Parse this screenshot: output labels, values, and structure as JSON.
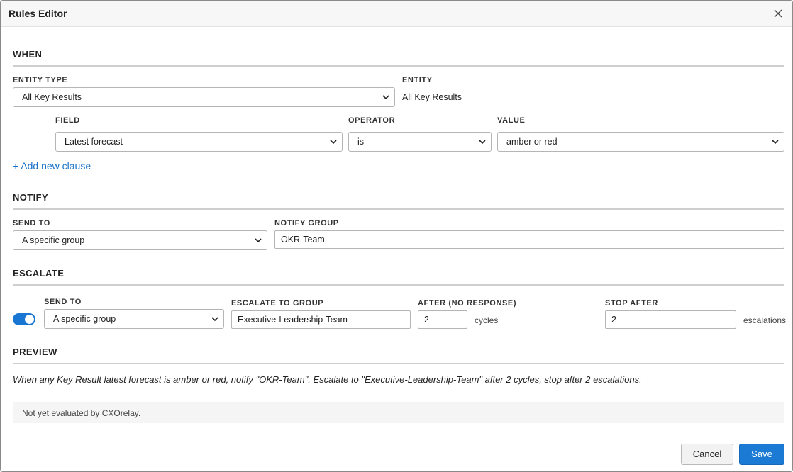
{
  "dialog": {
    "title": "Rules Editor"
  },
  "when": {
    "section_title": "WHEN",
    "entity_type_label": "ENTITY TYPE",
    "entity_type_value": "All Key Results",
    "entity_label": "ENTITY",
    "entity_value": "All Key Results",
    "field_label": "FIELD",
    "field_value": "Latest forecast",
    "operator_label": "OPERATOR",
    "operator_value": "is",
    "value_label": "VALUE",
    "value_value": "amber or red",
    "add_clause_label": "+ Add new clause"
  },
  "notify": {
    "section_title": "NOTIFY",
    "send_to_label": "SEND TO",
    "send_to_value": "A specific group",
    "group_label": "NOTIFY GROUP",
    "group_value": "OKR-Team"
  },
  "escalate": {
    "section_title": "ESCALATE",
    "enabled": true,
    "send_to_label": "SEND TO",
    "send_to_value": "A specific group",
    "group_label": "ESCALATE TO GROUP",
    "group_value": "Executive-Leadership-Team",
    "after_label": "AFTER (NO RESPONSE)",
    "after_value": "2",
    "after_unit": "cycles",
    "stop_label": "STOP AFTER",
    "stop_value": "2",
    "stop_unit": "escalations"
  },
  "preview": {
    "section_title": "PREVIEW",
    "text": "When any Key Result latest forecast is amber or red, notify \"OKR-Team\". Escalate to \"Executive-Leadership-Team\" after 2 cycles, stop after 2 escalations.",
    "status": "Not yet evaluated by CXOrelay."
  },
  "footer": {
    "cancel_label": "Cancel",
    "save_label": "Save"
  },
  "colors": {
    "accent": "#1a7ad4",
    "link": "#1a73c9",
    "toggle_on": "#1976d2"
  },
  "icons": {
    "close": "close-icon",
    "dropdown": "chevron-down-icon"
  }
}
